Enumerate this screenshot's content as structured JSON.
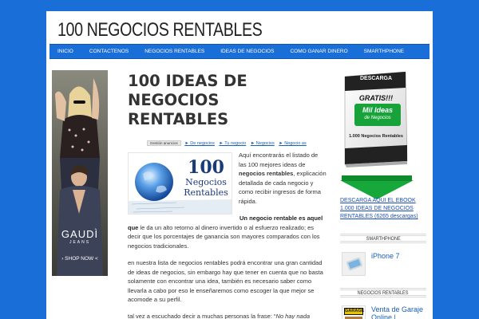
{
  "site": {
    "title": "100 NEGOCIOS RENTABLES"
  },
  "nav": {
    "items": [
      {
        "label": "INICIO"
      },
      {
        "label": "CONTACTENOS"
      },
      {
        "label": "NEGOCIOS RENTABLES"
      },
      {
        "label": "IDEAS DE NEGOCIOS"
      },
      {
        "label": "COMO GANAR DINERO"
      },
      {
        "label": "SMARTHPHONE"
      }
    ]
  },
  "ad_left": {
    "brand": "GAUDÌ",
    "sub": "JEANS",
    "cta": "› SHOP NOW <"
  },
  "post": {
    "title": "100 IDEAS DE NEGOCIOS RENTABLES",
    "breadcrumb": {
      "button": "Gestión anuncios",
      "links": [
        "► De negocios",
        "► Tu negocio",
        "► Negocios",
        "► Negocio as"
      ]
    },
    "image": {
      "number": "100",
      "line1": "Negocios",
      "line2": "Rentables"
    },
    "intro": {
      "before": "Aquí encontrarás el listado de las 100 mejores ideas de ",
      "bold": "negocios rentables",
      "after": ", explicación detallada de cada negocio y como recibir ingresos de forma rápida."
    },
    "p2": {
      "bold": "Un negocio rentable es aquel que",
      "after": " le da un alto retorno al dinero invertido o al esfuerzo realizado; es decir que los porcentajes de ganancia son mayores comparados con los negocios tradicionales."
    },
    "p3": "en nuestra lista de negocios rentables podrá encontrar una gran cantidad de ideas de negocios, sin embargo hay que tener en cuenta que no basta solamente con encontrar una idea, también es necesario saber como llevarla a cabo por eso le enseñaremos como escoger la que mejor se acomode a su perfil.",
    "p4": {
      "before": "tal vez a escuchado decir a muchas personas la frase: “",
      "italic": "No hay nada"
    }
  },
  "sidebar": {
    "ebook": {
      "line1": "DESCARGA",
      "line2": "GRATIS!!!",
      "line3": "Mil Ideas",
      "line4": "de Negocios",
      "line5": "1.000 Negocios Rentables"
    },
    "ebook_link": "DESCARGA AQUI EL EBOOK 1.000 IDEAS DE NEGOCIOS RENTABLES (6265 descargas)",
    "widgets": [
      {
        "title": "SMARTHPHONE",
        "entry": "iPhone 7"
      },
      {
        "title": "NEGOCIOS RENTABLES",
        "entry": "Venta de Garaje Online |"
      }
    ],
    "garage_thumb": "GARAGE"
  },
  "colors": {
    "background": "#1a6ed8",
    "nav": "#1a6ed8",
    "link": "#1a5fb4"
  }
}
